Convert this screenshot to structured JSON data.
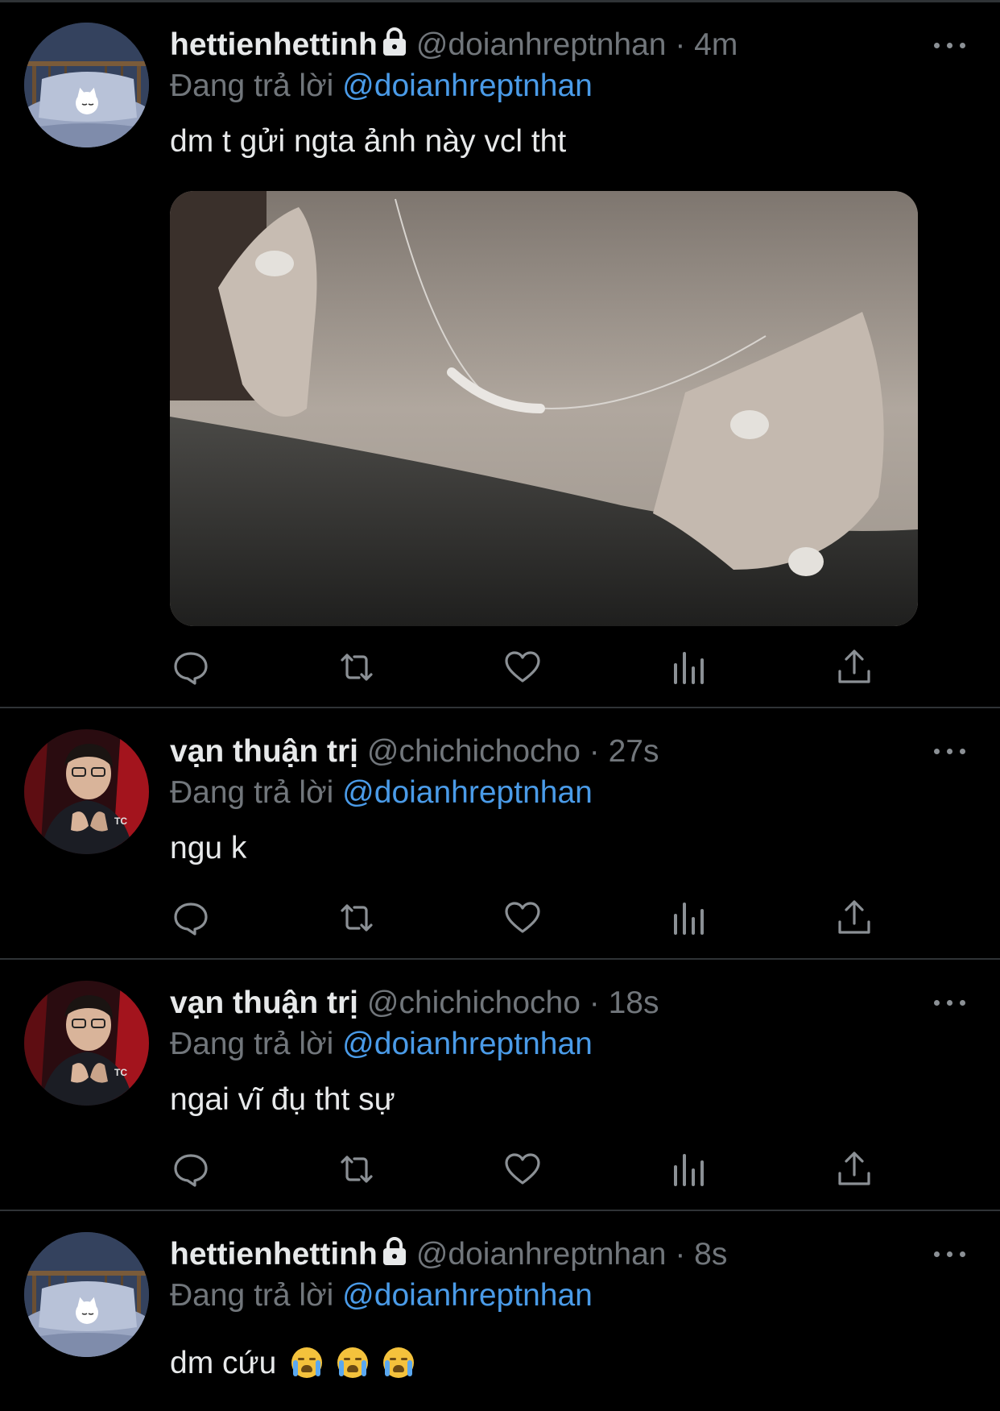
{
  "reply_prefix": "Đang trả lời",
  "tweets": [
    {
      "display_name": "hettienhettinh",
      "handle_time": "@doianhreptnhan · 4m",
      "protected": true,
      "reply_to": "@doianhreptnhan",
      "text": "dm t gửi ngta ảnh này vcl tht",
      "has_media": true,
      "avatar": "sleeping-cat-avatar"
    },
    {
      "display_name": "vạn thuận trị",
      "handle_time": "@chichichocho · 27s",
      "protected": false,
      "reply_to": "@doianhreptnhan",
      "text": "ngu k",
      "has_media": false,
      "avatar": "person-avatar"
    },
    {
      "display_name": "vạn thuận trị",
      "handle_time": "@chichichocho · 18s",
      "protected": false,
      "reply_to": "@doianhreptnhan",
      "text": "ngai vĩ đụ tht sự",
      "has_media": false,
      "avatar": "person-avatar"
    },
    {
      "display_name": "hettienhettinh",
      "handle_time": "@doianhreptnhan · 8s",
      "protected": true,
      "reply_to": "@doianhreptnhan",
      "text": "dm cứu",
      "emoji": [
        "loudly-crying-face",
        "loudly-crying-face",
        "loudly-crying-face"
      ],
      "has_media": false,
      "avatar": "sleeping-cat-avatar"
    }
  ],
  "action_icons": [
    "reply-icon",
    "retweet-icon",
    "like-icon",
    "views-icon",
    "share-icon"
  ],
  "colors": {
    "background": "#000000",
    "divider": "#2f3336",
    "primary_text": "#e7e9ea",
    "secondary_text": "#71767b",
    "mention": "#4a9be8"
  }
}
